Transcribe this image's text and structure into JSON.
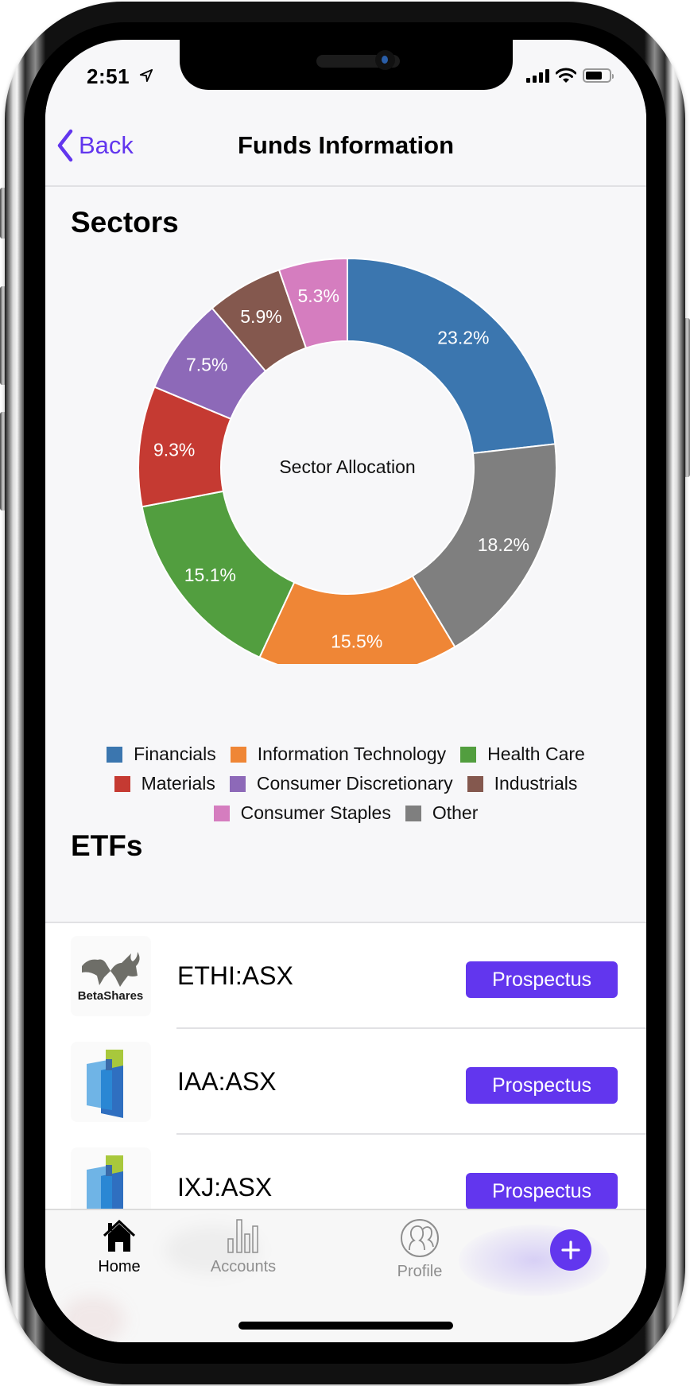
{
  "status_bar": {
    "time": "2:51"
  },
  "navbar": {
    "back_label": "Back",
    "title": "Funds Information"
  },
  "sectors": {
    "heading": "Sectors"
  },
  "chart_data": {
    "type": "pie",
    "variant": "donut",
    "title": "Sector Allocation",
    "start": "top",
    "direction": "clockwise",
    "slices": [
      {
        "label": "Financials",
        "value": 23.2,
        "display": "23.2%",
        "color": "#3b76af"
      },
      {
        "label": "Other",
        "value": 18.2,
        "display": "18.2%",
        "color": "#7f7f7f"
      },
      {
        "label": "Information Technology",
        "value": 15.5,
        "display": "15.5%",
        "color": "#ef8636"
      },
      {
        "label": "Health Care",
        "value": 15.1,
        "display": "15.1%",
        "color": "#529e3f"
      },
      {
        "label": "Materials",
        "value": 9.3,
        "display": "9.3%",
        "color": "#c53a32"
      },
      {
        "label": "Consumer Discretionary",
        "value": 7.5,
        "display": "7.5%",
        "color": "#8d69b8"
      },
      {
        "label": "Industrials",
        "value": 5.9,
        "display": "5.9%",
        "color": "#84584e"
      },
      {
        "label": "Consumer Staples",
        "value": 5.3,
        "display": "5.3%",
        "color": "#d57dbf"
      }
    ],
    "legend": {
      "placement": "bottom",
      "rows": [
        [
          {
            "label": "Financials",
            "color": "#3b76af"
          },
          {
            "label": "Information Technology",
            "color": "#ef8636"
          },
          {
            "label": "Health Care",
            "color": "#529e3f"
          }
        ],
        [
          {
            "label": "Materials",
            "color": "#c53a32"
          },
          {
            "label": "Consumer Discretionary",
            "color": "#8d69b8"
          },
          {
            "label": "Industrials",
            "color": "#84584e"
          }
        ],
        [
          {
            "label": "Consumer Staples",
            "color": "#d57dbf"
          },
          {
            "label": "Other",
            "color": "#7f7f7f"
          }
        ]
      ]
    }
  },
  "etfs": {
    "heading": "ETFs",
    "items": [
      {
        "ticker": "ETHI:ASX",
        "logo": "betashares-logo",
        "logo_text": "BetaShares",
        "button_label": "Prospectus"
      },
      {
        "ticker": "IAA:ASX",
        "logo": "ishares-logo",
        "button_label": "Prospectus"
      },
      {
        "ticker": "IXJ:ASX",
        "logo": "ishares-logo",
        "button_label": "Prospectus"
      }
    ]
  },
  "tabbar": {
    "tabs": [
      {
        "label": "Home",
        "icon": "home-icon",
        "active": true
      },
      {
        "label": "Accounts",
        "icon": "bar-chart-icon",
        "active": false
      },
      {
        "label": "Profile",
        "icon": "profile-icon",
        "active": false
      }
    ],
    "add_button": {
      "icon": "plus-icon"
    }
  },
  "colors": {
    "accent": "#6236ee",
    "active_tab": "#000000",
    "inactive_tab": "#8e8e8e"
  }
}
